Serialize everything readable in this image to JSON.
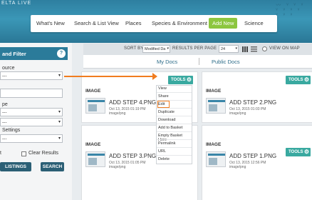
{
  "header": {
    "brand": "ELTA LIVE"
  },
  "nav": {
    "items": [
      "What's New",
      "Search & List View",
      "Places",
      "Species & Environment",
      "Add New",
      "Science"
    ],
    "active": "Add New"
  },
  "sidebar": {
    "title": "and Filter",
    "help": "?",
    "source_label": "ource",
    "source_value": "---",
    "type_label": "pe",
    "type_value": "---",
    "select3_value": "---",
    "settings_label": "Settings",
    "settings_value": "---",
    "partial_label": "t",
    "clear_label": "Clear Results",
    "listings_button": "LISTINGS",
    "search_button": "SEARCH"
  },
  "toolbar": {
    "sort_by": "SORT BY",
    "sort_value": "Modified Da",
    "per_page_label": "RESULTS PER PAGE",
    "per_page_value": "24",
    "view_on_map": "VIEW ON MAP"
  },
  "tabs": {
    "my_docs": "My Docs",
    "public_docs": "Public Docs"
  },
  "tools_label": "TOOLS",
  "cards": [
    {
      "type": "IMAGE",
      "title": "ADD STEP 4.PNG",
      "date": "Oct 13, 2015 01:19 PM",
      "mime": "image/png"
    },
    {
      "type": "IMAGE",
      "title": "ADD STEP 2.PNG",
      "date": "Oct 13, 2015 01:03 PM",
      "mime": "image/png"
    },
    {
      "type": "IMAGE",
      "title": "ADD STEP 3.PNG",
      "date": "Oct 13, 2015 01:05 PM",
      "mime": "image/png"
    },
    {
      "type": "IMAGE",
      "title": "ADD STEP 1.PNG",
      "date": "Oct 13, 2015 12:56 PM",
      "mime": "image/png"
    }
  ],
  "menu": {
    "items": [
      "View",
      "Share",
      "Edit",
      "Duplicate",
      "Download",
      "Add to Basket",
      "Empty Basket Here",
      "Permalink",
      "URL",
      "Delete"
    ],
    "highlighted": "Edit"
  },
  "colors": {
    "accent_green": "#8cc63f",
    "teal": "#39a9a0",
    "highlight_orange": "#f07c1f",
    "header_blue": "#2e7fa0"
  }
}
